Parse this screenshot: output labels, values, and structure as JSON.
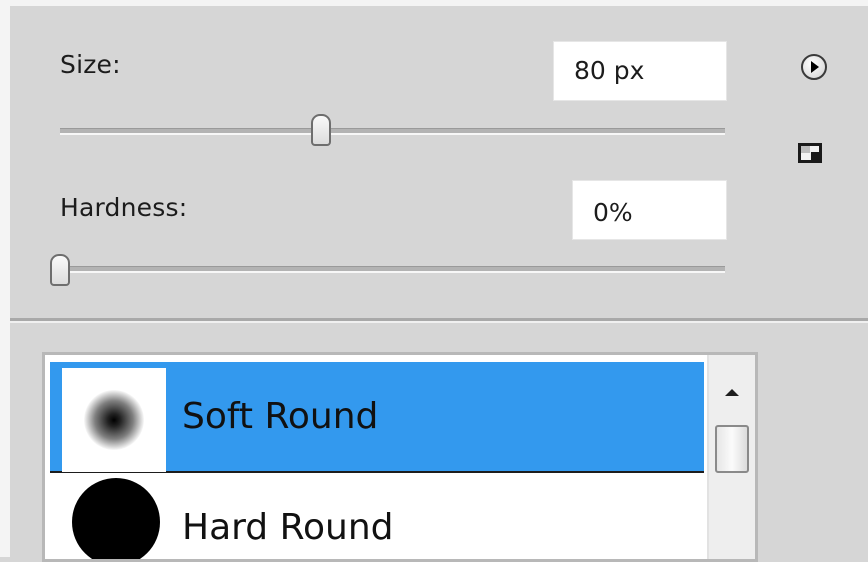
{
  "size": {
    "label": "Size:",
    "value": "80 px",
    "slider_level_percent": 40
  },
  "hardness": {
    "label": "Hardness:",
    "value": "0%",
    "slider_level_percent": 0
  },
  "icons": {
    "menu": "flyout-menu-icon",
    "new_preset": "new-preset-icon"
  },
  "presets": {
    "items": [
      {
        "label": "Soft Round",
        "selected": true
      },
      {
        "label": "Hard Round",
        "selected": false
      }
    ]
  },
  "colors": {
    "selection": "#3399ee",
    "panel_bg": "#d6d6d6"
  }
}
